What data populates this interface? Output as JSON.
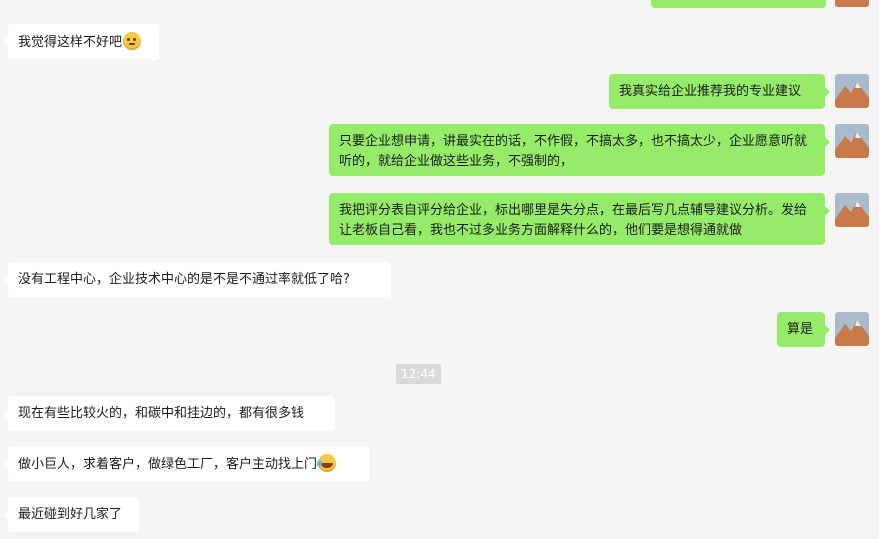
{
  "colors": {
    "background": "#f5f5f5",
    "incoming_bubble": "#ffffff",
    "outgoing_bubble": "#95ec69",
    "time_badge": "#dadada"
  },
  "messages": [
    {
      "direction": "in",
      "text": "我觉得这样不好吧",
      "emoji": "thinking-face-icon"
    },
    {
      "direction": "out",
      "text": "我真实给企业推荐我的专业建议"
    },
    {
      "direction": "out",
      "text": "只要企业想申请，讲最实在的话，不作假，不搞太多，也不搞太少，企业愿意听就听的，就给企业做这些业务，不强制的，"
    },
    {
      "direction": "out",
      "text": "我把评分表自评分给企业，标出哪里是失分点，在最后写几点辅导建议分析。发给让老板自己看，我也不过多业务方面解释什么的，他们要是想得通就做"
    },
    {
      "direction": "in",
      "text": "没有工程中心，企业技术中心的是不是不通过率就低了哈?"
    },
    {
      "direction": "out",
      "text": "算是"
    },
    {
      "direction": "in",
      "text": "现在有些比较火的，和碳中和挂边的，都有很多钱"
    },
    {
      "direction": "in",
      "text": "做小巨人，求着客户，做绿色工厂，客户主动找上门",
      "emoji": "laughing-tears-icon"
    },
    {
      "direction": "in",
      "text": "最近碰到好几家了"
    }
  ],
  "timestamp": "12:44"
}
